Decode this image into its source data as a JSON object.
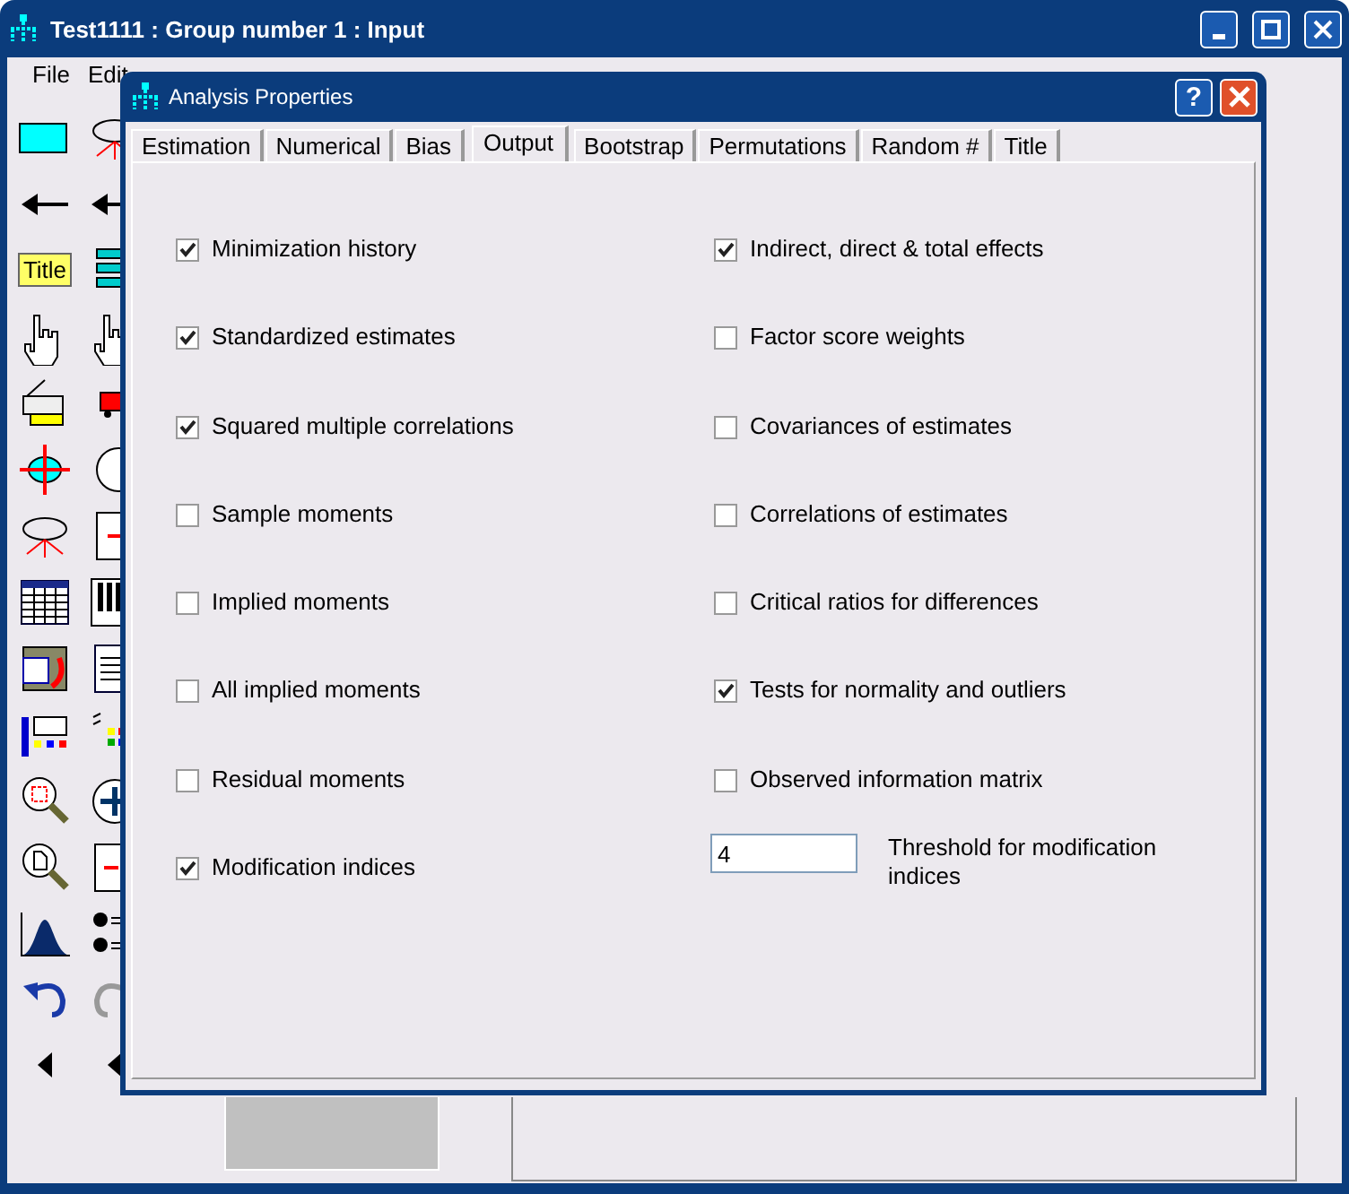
{
  "window": {
    "title": "Test1111 : Group number 1 : Input"
  },
  "menu": [
    {
      "label": "File"
    },
    {
      "label": "Edit"
    }
  ],
  "toolbar": {
    "title_tool": "Title"
  },
  "dialog": {
    "title": "Analysis Properties",
    "help": "?",
    "tabs": [
      {
        "label": "Estimation",
        "selected": false
      },
      {
        "label": "Numerical",
        "selected": false
      },
      {
        "label": "Bias",
        "selected": false
      },
      {
        "label": "Output",
        "selected": true
      },
      {
        "label": "Bootstrap",
        "selected": false
      },
      {
        "label": "Permutations",
        "selected": false
      },
      {
        "label": "Random #",
        "selected": false
      },
      {
        "label": "Title",
        "selected": false
      }
    ],
    "left_options": [
      {
        "label": "Minimization history",
        "checked": true
      },
      {
        "label": "Standardized estimates",
        "checked": true
      },
      {
        "label": "Squared multiple correlations",
        "checked": true
      },
      {
        "label": "Sample moments",
        "checked": false
      },
      {
        "label": "Implied moments",
        "checked": false
      },
      {
        "label": "All implied moments",
        "checked": false
      },
      {
        "label": "Residual moments",
        "checked": false
      },
      {
        "label": "Modification indices",
        "checked": true
      }
    ],
    "right_options": [
      {
        "label": "Indirect, direct & total effects",
        "checked": true
      },
      {
        "label": "Factor score weights",
        "checked": false
      },
      {
        "label": "Covariances of estimates",
        "checked": false
      },
      {
        "label": "Correlations of estimates",
        "checked": false
      },
      {
        "label": "Critical ratios for differences",
        "checked": false
      },
      {
        "label": "Tests for normality and outliers",
        "checked": true
      },
      {
        "label": "Observed information matrix",
        "checked": false
      }
    ],
    "threshold": {
      "value": "4",
      "label": "Threshold for modification indices"
    }
  }
}
